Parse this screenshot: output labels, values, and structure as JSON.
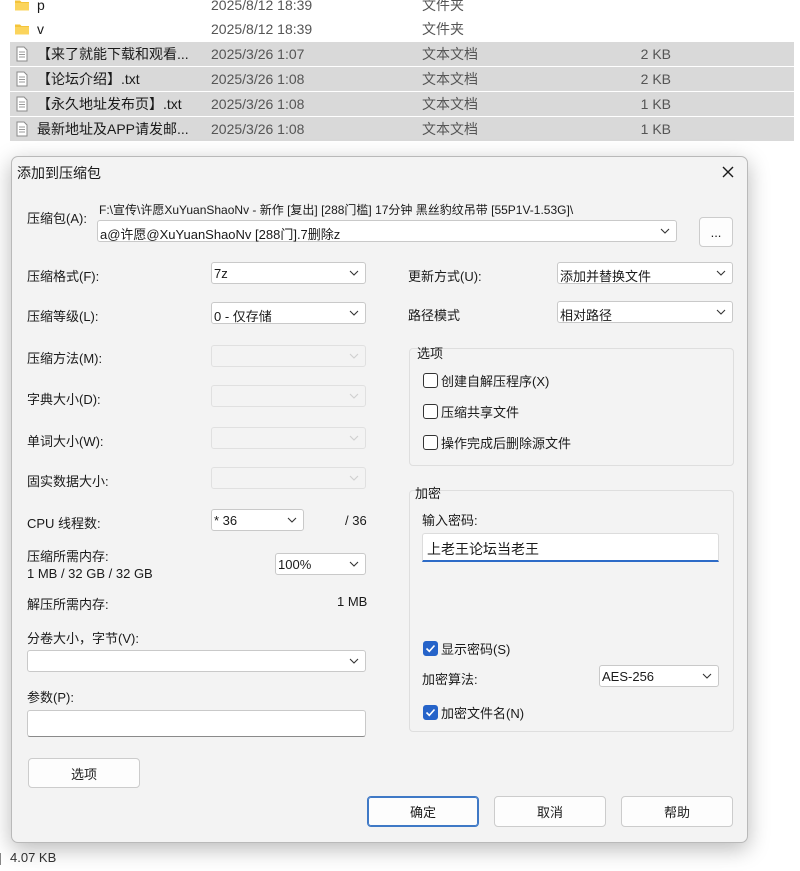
{
  "files": [
    {
      "icon": "folder-icon",
      "name": "p",
      "date": "2025/8/12 18:39",
      "type": "文件夹",
      "size": "",
      "selected": false
    },
    {
      "icon": "folder-icon",
      "name": "v",
      "date": "2025/8/12 18:39",
      "type": "文件夹",
      "size": "",
      "selected": false
    },
    {
      "icon": "text-file-icon",
      "name": "【来了就能下载和观看...",
      "date": "2025/3/26 1:07",
      "type": "文本文档",
      "size": "2 KB",
      "selected": true
    },
    {
      "icon": "text-file-icon",
      "name": "【论坛介绍】.txt",
      "date": "2025/3/26 1:08",
      "type": "文本文档",
      "size": "2 KB",
      "selected": true
    },
    {
      "icon": "text-file-icon",
      "name": "【永久地址发布页】.txt",
      "date": "2025/3/26 1:08",
      "type": "文本文档",
      "size": "1 KB",
      "selected": true
    },
    {
      "icon": "text-file-icon",
      "name": "最新地址及APP请发邮...",
      "date": "2025/3/26 1:08",
      "type": "文本文档",
      "size": "1 KB",
      "selected": true
    }
  ],
  "status": {
    "size_text": "4.07 KB"
  },
  "dialog": {
    "title": "添加到压缩包",
    "archive": {
      "label": "压缩包(A):",
      "path_line": "F:\\宣传\\许愿XuYuanShaoNv - 新作 [复出] [288门槛] 17分钟 黑丝豹纹吊带 [55P1V-1.53G]\\",
      "name_value": "a@许愿@XuYuanShaoNv [288门].7删除z",
      "browse_label": "..."
    },
    "left": {
      "format_label": "压缩格式(F):",
      "format_value": "7z",
      "level_label": "压缩等级(L):",
      "level_value": "0 - 仅存储",
      "method_label": "压缩方法(M):",
      "dict_label": "字典大小(D):",
      "word_label": "单词大小(W):",
      "solid_label": "固实数据大小:",
      "cpu_label": "CPU 线程数:",
      "cpu_value": "* 36",
      "cpu_total": "/ 36",
      "mem_comp_label": "压缩所需内存:",
      "mem_comp_value": "1 MB / 32 GB / 32 GB",
      "mem_percent": "100%",
      "mem_decomp_label": "解压所需内存:",
      "mem_decomp_value": "1 MB",
      "volume_label": "分卷大小，字节(V):",
      "volume_value": "",
      "params_label": "参数(P):",
      "params_value": "",
      "options_button": "选项"
    },
    "right": {
      "update_label": "更新方式(U):",
      "update_value": "添加并替换文件",
      "path_label": "路径模式",
      "path_value": "相对路径",
      "options_group": "选项",
      "opt_sfx": "创建自解压程序(X)",
      "opt_shared": "压缩共享文件",
      "opt_delete": "操作完成后删除源文件",
      "encrypt_group": "加密",
      "pwd_label": "输入密码:",
      "pwd_value": "上老王论坛当老王",
      "show_pwd": "显示密码(S)",
      "algo_label": "加密算法:",
      "algo_value": "AES-256",
      "encrypt_names": "加密文件名(N)"
    },
    "buttons": {
      "ok": "确定",
      "cancel": "取消",
      "help": "帮助"
    }
  }
}
